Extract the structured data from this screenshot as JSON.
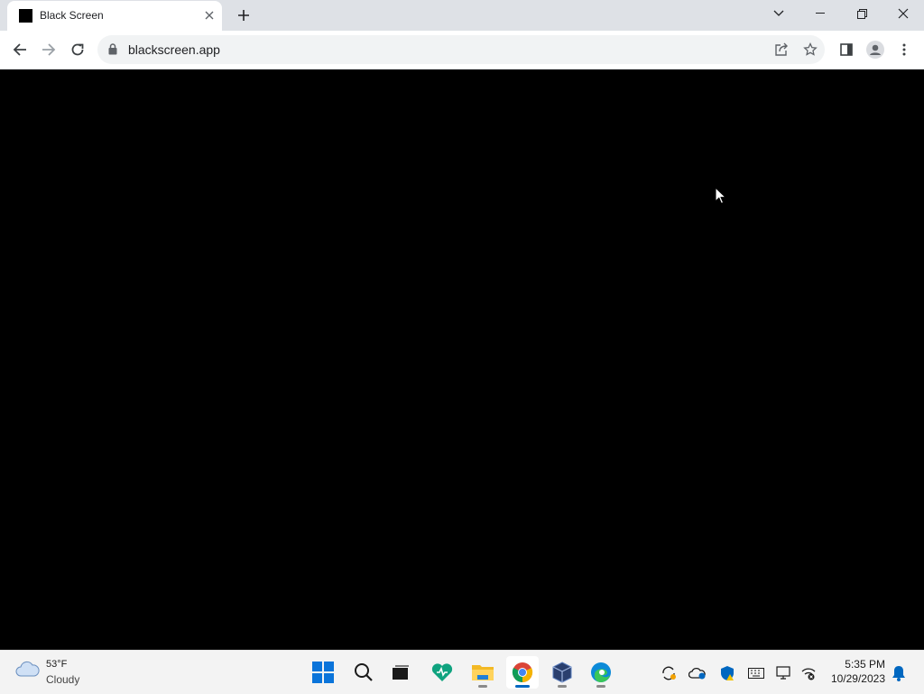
{
  "browser": {
    "tab": {
      "title": "Black Screen",
      "favicon": "black-square-icon"
    },
    "address": {
      "url": "blackscreen.app"
    },
    "icons": [
      "back-icon",
      "forward-icon",
      "reload-icon",
      "lock-icon",
      "share-icon",
      "star-icon",
      "side-panel-icon",
      "profile-icon",
      "menu-icon"
    ]
  },
  "page": {
    "background": "#000000"
  },
  "taskbar": {
    "weather": {
      "temp": "53°F",
      "condition": "Cloudy",
      "icon": "cloud-icon"
    },
    "apps": [
      "windows-start-icon",
      "search-icon",
      "task-view-icon",
      "health-app-icon",
      "file-explorer-icon",
      "chrome-icon",
      "virtualbox-icon",
      "edge-icon"
    ],
    "tray": [
      "sync-icon",
      "onedrive-icon",
      "security-icon",
      "keyboard-icon",
      "display-icon",
      "network-icon",
      "notification-bell-icon"
    ],
    "clock": {
      "time": "5:35 PM",
      "date": "10/29/2023"
    }
  },
  "colors": {
    "accent": "#0067c0",
    "tabstrip": "#dee1e6",
    "taskbar": "#f3f3f3"
  }
}
